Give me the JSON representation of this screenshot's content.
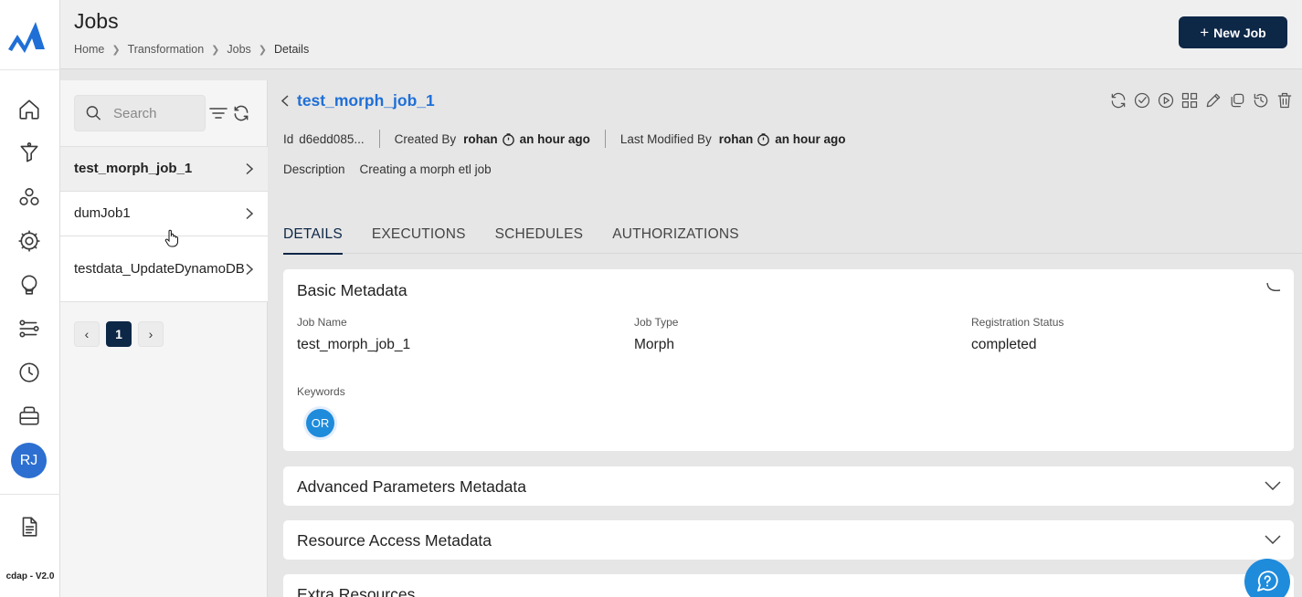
{
  "app": {
    "version": "cdap - V2.0",
    "user_initials": "RJ"
  },
  "sidebar": {
    "items": [
      {
        "name": "home-icon"
      },
      {
        "name": "transformation-icon"
      },
      {
        "name": "clusters-icon"
      },
      {
        "name": "settings-icon"
      },
      {
        "name": "lightbulb-icon"
      },
      {
        "name": "pipeline-icon"
      },
      {
        "name": "clock-icon"
      },
      {
        "name": "storage-icon"
      }
    ],
    "bottom_items": [
      {
        "name": "document-icon"
      }
    ]
  },
  "header": {
    "title": "Jobs",
    "breadcrumb": [
      "Home",
      "Transformation",
      "Jobs",
      "Details"
    ],
    "new_job_label": "New Job"
  },
  "left_panel": {
    "search_placeholder": "Search",
    "jobs": [
      {
        "name": "test_morph_job_1",
        "active": true
      },
      {
        "name": "dumJob1",
        "active": false
      },
      {
        "name": "testdata_UpdateDynamoDB",
        "active": false
      }
    ],
    "pagination": {
      "current_page": "1"
    }
  },
  "job": {
    "title": "test_morph_job_1",
    "id_label": "Id",
    "id_value": "d6edd085...",
    "created_by_label": "Created By",
    "created_by": "rohan",
    "created_time": "an hour ago",
    "modified_by_label": "Last Modified By",
    "modified_by": "rohan",
    "modified_time": "an hour ago",
    "description_label": "Description",
    "description": "Creating a morph etl job",
    "actions": [
      "refresh-icon",
      "check-icon",
      "run-icon",
      "grid-icon",
      "edit-icon",
      "copy-icon",
      "history-icon",
      "delete-icon"
    ]
  },
  "tabs": [
    "DETAILS",
    "EXECUTIONS",
    "SCHEDULES",
    "AUTHORIZATIONS"
  ],
  "active_tab": "DETAILS",
  "basic_metadata": {
    "title": "Basic Metadata",
    "job_name_label": "Job Name",
    "job_name": "test_morph_job_1",
    "job_type_label": "Job Type",
    "job_type": "Morph",
    "registration_status_label": "Registration Status",
    "registration_status": "completed",
    "keywords_label": "Keywords",
    "keywords": [
      "OR"
    ]
  },
  "sections": {
    "advanced": "Advanced Parameters Metadata",
    "resource": "Resource Access Metadata",
    "extra": "Extra Resources"
  },
  "colors": {
    "primary": "#0d2747",
    "link": "#1f6fd6",
    "accent": "#1f8bdb"
  }
}
